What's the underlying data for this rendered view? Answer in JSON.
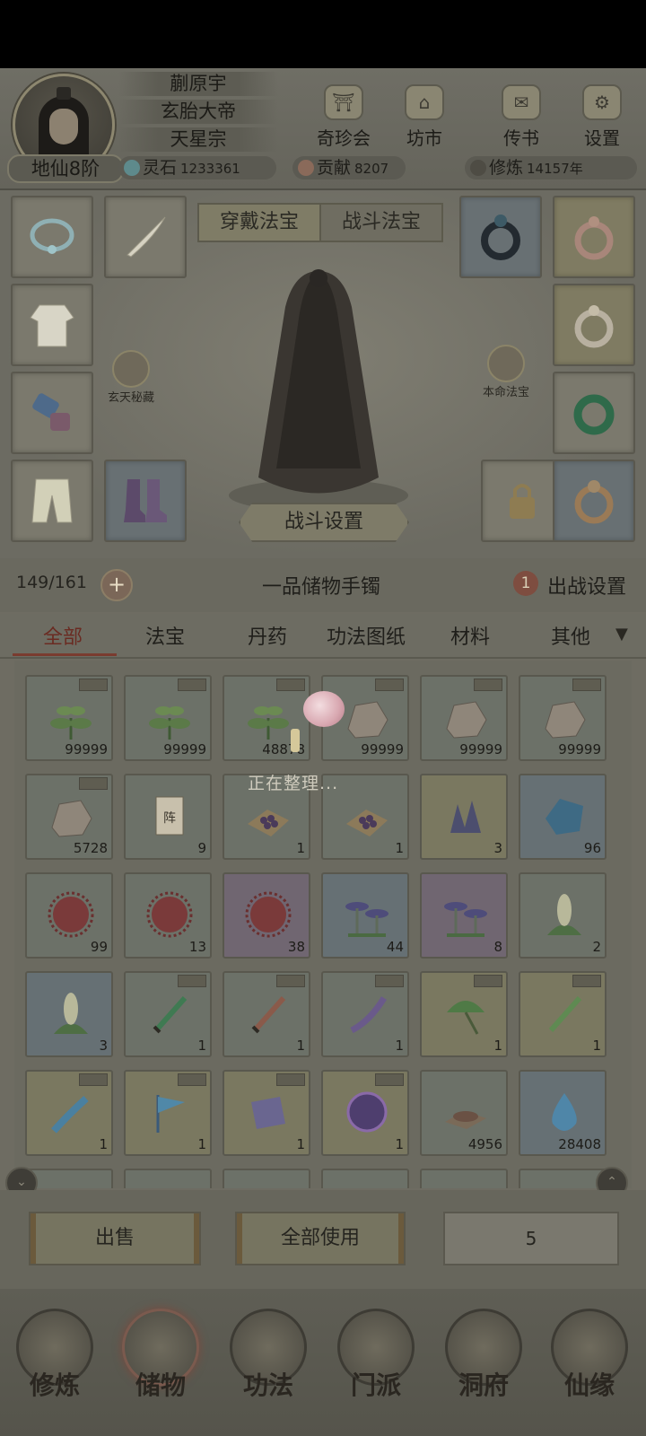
{
  "player": {
    "name": "蒯原宇",
    "title": "玄胎大帝",
    "sect": "天星宗",
    "realm": "地仙8阶"
  },
  "resources": [
    {
      "label": "灵石",
      "value": "1233361",
      "color": "#5e8a8c",
      "icon": "spirit-stone-icon"
    },
    {
      "label": "贡献",
      "value": "8207",
      "color": "#8a6a5a",
      "icon": "contribution-icon"
    },
    {
      "label": "修炼",
      "value": "14157年",
      "color": "#4e4c44",
      "icon": "cultivation-icon"
    }
  ],
  "top_buttons": [
    {
      "label": "奇珍会",
      "icon": "treasure-hall-icon"
    },
    {
      "label": "坊市",
      "icon": "market-icon"
    },
    {
      "label": "传书",
      "icon": "scroll-mail-icon"
    },
    {
      "label": "设置",
      "icon": "gear-icon"
    }
  ],
  "equip_tabs": {
    "worn": "穿戴法宝",
    "battle": "战斗法宝"
  },
  "skills": {
    "left": "玄天秘藏",
    "right": "本命法宝"
  },
  "fight_setting": "战斗设置",
  "bag": {
    "capacity": "149/161",
    "title": "一品储物手镯",
    "sortie_badge": "1",
    "sortie_label": "出战设置",
    "sorting_text": "正在整理..."
  },
  "filter_tabs": [
    "全部",
    "法宝",
    "丹药",
    "功法图纸",
    "材料",
    "其他"
  ],
  "items": [
    {
      "icon": "herb-icon",
      "count": "99999",
      "tag": true,
      "bg": "g"
    },
    {
      "icon": "herb-icon",
      "count": "99999",
      "tag": true,
      "bg": "g"
    },
    {
      "icon": "herb-icon",
      "count": "48878",
      "tag": true,
      "bg": "g"
    },
    {
      "icon": "ore-icon",
      "count": "99999",
      "tag": true,
      "bg": "g"
    },
    {
      "icon": "ore-icon",
      "count": "99999",
      "tag": true,
      "bg": "g"
    },
    {
      "icon": "ore-icon",
      "count": "99999",
      "tag": true,
      "bg": "g"
    },
    {
      "icon": "ore-icon",
      "count": "5728",
      "tag": true,
      "bg": "g"
    },
    {
      "icon": "array-scroll-icon",
      "count": "9",
      "tag": false,
      "bg": "g"
    },
    {
      "icon": "berries-cloth-icon",
      "count": "1",
      "tag": false,
      "bg": "g"
    },
    {
      "icon": "berries-cloth-icon",
      "count": "1",
      "tag": false,
      "bg": "g"
    },
    {
      "icon": "crystal-cluster-icon",
      "count": "3",
      "tag": false,
      "bg": "y"
    },
    {
      "icon": "blue-crystal-icon",
      "count": "96",
      "tag": false,
      "bg": "b"
    },
    {
      "icon": "spiky-fruit-icon",
      "count": "99",
      "tag": false,
      "bg": "g"
    },
    {
      "icon": "spiky-fruit-icon",
      "count": "13",
      "tag": false,
      "bg": "g"
    },
    {
      "icon": "spiky-fruit-icon",
      "count": "38",
      "tag": false,
      "bg": "p"
    },
    {
      "icon": "mushroom-icon",
      "count": "44",
      "tag": false,
      "bg": "b"
    },
    {
      "icon": "mushroom-icon",
      "count": "8",
      "tag": false,
      "bg": "p"
    },
    {
      "icon": "corn-herb-icon",
      "count": "2",
      "tag": false,
      "bg": "g"
    },
    {
      "icon": "corn-herb-icon",
      "count": "3",
      "tag": false,
      "bg": "b"
    },
    {
      "icon": "green-sword-icon",
      "count": "1",
      "tag": true,
      "bg": "g"
    },
    {
      "icon": "red-sword-icon",
      "count": "1",
      "tag": true,
      "bg": "g"
    },
    {
      "icon": "purple-blade-icon",
      "count": "1",
      "tag": true,
      "bg": "g"
    },
    {
      "icon": "leaf-umbrella-icon",
      "count": "1",
      "tag": true,
      "bg": "y"
    },
    {
      "icon": "jade-blade-icon",
      "count": "1",
      "tag": true,
      "bg": "y"
    },
    {
      "icon": "blue-saber-icon",
      "count": "1",
      "tag": true,
      "bg": "y"
    },
    {
      "icon": "blue-flag-icon",
      "count": "1",
      "tag": true,
      "bg": "y"
    },
    {
      "icon": "purple-scroll-icon",
      "count": "1",
      "tag": true,
      "bg": "y"
    },
    {
      "icon": "purple-orb-icon",
      "count": "1",
      "tag": true,
      "bg": "y"
    },
    {
      "icon": "powder-icon",
      "count": "4956",
      "tag": false,
      "bg": "g"
    },
    {
      "icon": "water-drop-icon",
      "count": "28408",
      "tag": false,
      "bg": "b"
    }
  ],
  "actions": {
    "sell": "出售",
    "use_all": "全部使用",
    "quantity": "5"
  },
  "nav": [
    {
      "label": "修炼",
      "icon": "cultivate-icon"
    },
    {
      "label": "储物",
      "icon": "storage-bag-icon"
    },
    {
      "label": "功法",
      "icon": "technique-scroll-icon"
    },
    {
      "label": "门派",
      "icon": "sect-gate-icon"
    },
    {
      "label": "洞府",
      "icon": "cave-mansion-icon"
    },
    {
      "label": "仙缘",
      "icon": "immortal-fate-icon"
    }
  ],
  "colors": {
    "active_tab": "#6a2b22",
    "overlay": "#6e6c62"
  }
}
